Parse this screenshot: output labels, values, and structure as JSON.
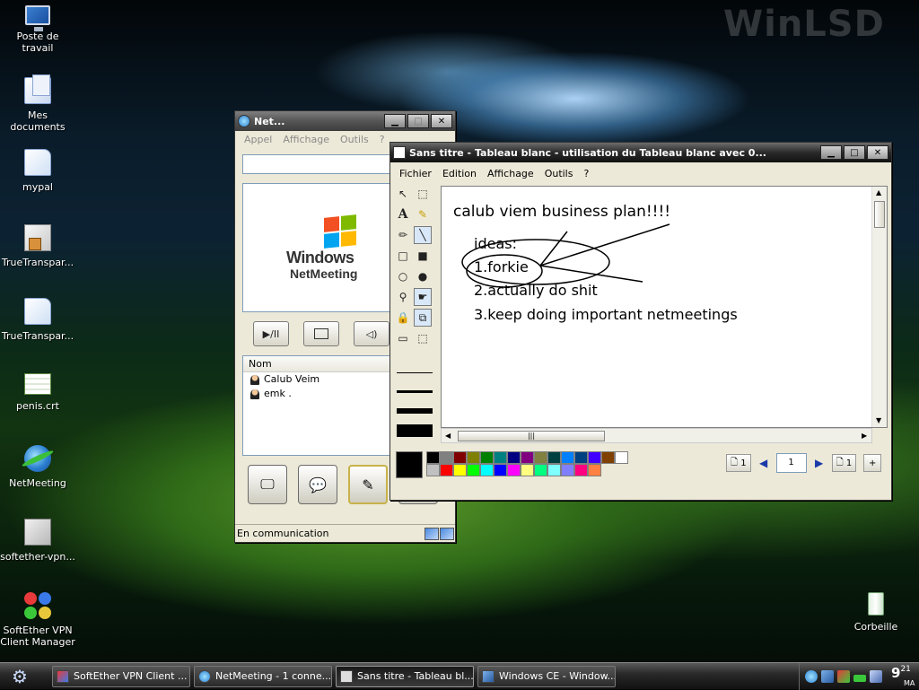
{
  "desktop": {
    "watermark": "WinLSD",
    "icons": [
      {
        "label": "Poste de travail",
        "icon": "computer-icon"
      },
      {
        "label": "Mes documents",
        "icon": "documents-icon"
      },
      {
        "label": "mypal",
        "icon": "file-icon"
      },
      {
        "label": "TrueTranspar...",
        "icon": "exe-icon"
      },
      {
        "label": "TrueTranspar...",
        "icon": "file-icon"
      },
      {
        "label": "penis.crt",
        "icon": "certificate-icon"
      },
      {
        "label": "NetMeeting",
        "icon": "netmeeting-icon"
      },
      {
        "label": "softether-vpn...",
        "icon": "installer-icon"
      },
      {
        "label": "SoftEther VPN Client Manager",
        "icon": "vpn-icon"
      }
    ],
    "recycle_bin": "Corbeille"
  },
  "netmeeting": {
    "title": "Net...",
    "menu": [
      "Appel",
      "Affichage",
      "Outils",
      "?"
    ],
    "logo_line1": "Windows",
    "logo_line2": "NetMeeting",
    "list_header": "Nom",
    "participants": [
      "Calub Veim",
      "emk ."
    ],
    "status": "En communication",
    "controls": {
      "play_pause": "▶/II"
    }
  },
  "whiteboard": {
    "title": "Sans titre - Tableau blanc - utilisation du Tableau blanc avec 0...",
    "menu": [
      "Fichier",
      "Edition",
      "Affichage",
      "Outils",
      "?"
    ],
    "canvas_text": {
      "heading": "calub viem business plan!!!!",
      "ideas": "ideas:",
      "item1": "1.forkie",
      "item2": "2.actually do shit",
      "item3": "3.keep doing important netmeetings"
    },
    "pager": {
      "pages_left": "1",
      "current_page": "1",
      "pages_right": "1"
    },
    "palette": [
      "#000000",
      "#808080",
      "#800000",
      "#808000",
      "#008000",
      "#008080",
      "#000080",
      "#800080",
      "#808040",
      "#004040",
      "#0080ff",
      "#004080",
      "#4000ff",
      "#804000",
      "#ffffff",
      "#c0c0c0",
      "#ff0000",
      "#ffff00",
      "#00ff00",
      "#00ffff",
      "#0000ff",
      "#ff00ff",
      "#ffff80",
      "#00ff80",
      "#80ffff",
      "#8080ff",
      "#ff0080",
      "#ff8040"
    ]
  },
  "taskbar": {
    "tasks": [
      {
        "label": "SoftEther VPN Client ..."
      },
      {
        "label": "NetMeeting - 1 conne..."
      },
      {
        "label": "Sans titre - Tableau bl..."
      },
      {
        "label": "Windows CE - Window..."
      }
    ],
    "clock_hour": "9",
    "clock_minutes": "21",
    "clock_ampm": "MA"
  }
}
